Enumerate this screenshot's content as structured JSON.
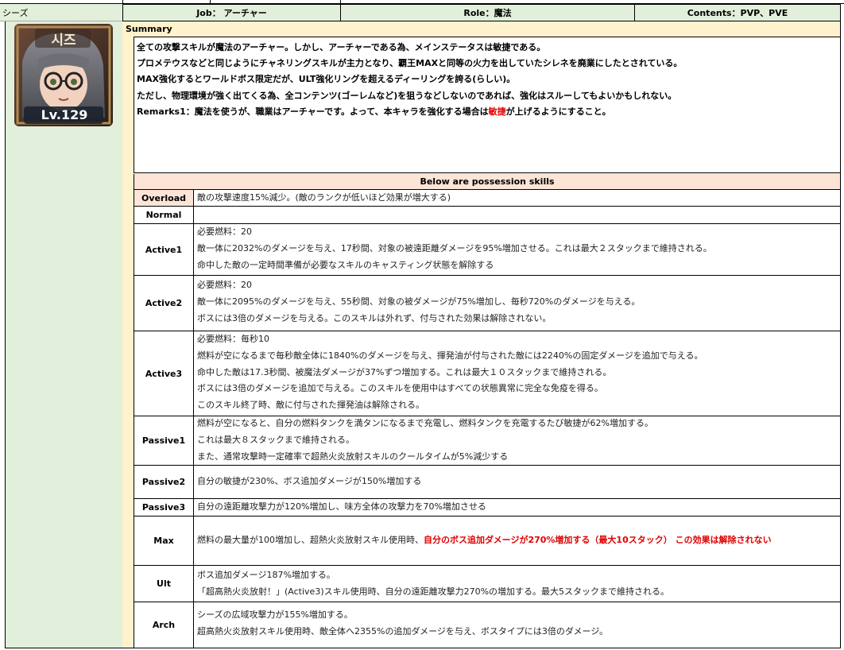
{
  "character_name": "シーズ",
  "header": {
    "job": "Job： アーチャー",
    "role": "Role：魔法",
    "contents": "Contents：PVP、PVE"
  },
  "avatar": {
    "name_badge": "시즈",
    "level": "Lv.129"
  },
  "summary": {
    "title": "Summary",
    "lines": [
      "全ての攻撃スキルが魔法のアーチャー。しかし、アーチャーである為、メインステータスは敏捷である。",
      "プロメテウスなどと同じようにチャネリングスキルが主力となり、覇王MAXと同等の火力を出していたシレネを廃業にしたとされている。",
      "MAX強化するとワールドボス限定だが、ULT強化リングを超えるディーリングを誇る(らしい)。",
      "ただし、物理環境が強く出てくる為、全コンテンツ(ゴーレムなど)を狙うなどしないのであれば、強化はスルーしてもよいかもしれない。"
    ],
    "remarks_prefix": "Remarks1：魔法を使うが、職業はアーチャーです。よって、本キャラを強化する場合は",
    "remarks_highlight": "敏捷",
    "remarks_suffix": "が上げるようにすること。"
  },
  "skills_title": "Below are possession skills",
  "skills": {
    "overload": {
      "label": "Overload",
      "lines": [
        "敵の攻撃速度15%減少。(敵のランクが低いほど効果が増大する)"
      ]
    },
    "normal": {
      "label": "Normal",
      "lines": []
    },
    "active1": {
      "label": "Active1",
      "lines": [
        "必要燃料：20",
        "敵一体に2032%のダメージを与え、17秒間、対象の被遠距離ダメージを95%増加させる。これは最大２スタックまで維持される。",
        "命中した敵の一定時間準備が必要なスキルのキャスティング状態を解除する"
      ]
    },
    "active2": {
      "label": "Active2",
      "lines": [
        "必要燃料：20",
        "敵一体に2095%のダメージを与え、55秒間、対象の被ダメージが75%増加し、毎秒720%のダメージを与える。",
        "ボスには3倍のダメージを与える。このスキルは外れず、付与された効果は解除されない。"
      ]
    },
    "active3": {
      "label": "Active3",
      "lines": [
        "必要燃料：毎秒10",
        "燃料が空になるまで毎秒敵全体に1840%のダメージを与え、揮発油が付与された敵には2240%の固定ダメージを追加で与える。",
        "命中した敵は17.3秒間、被魔法ダメージが37%ずつ増加する。これは最大１０スタックまで維持される。",
        "ボスには3倍のダメージを追加で与える。このスキルを使用中はすべての状態異常に完全な免疫を得る。",
        "このスキル終了時、敵に付与された揮発油は解除される。"
      ]
    },
    "passive1": {
      "label": "Passive1",
      "lines": [
        "燃料が空になると、自分の燃料タンクを満タンになるまで充電し、燃料タンクを充電するたび敏捷が62%増加する。",
        "これは最大８スタックまで維持される。",
        "また、通常攻撃時一定確率で超熱火炎放射スキルのクールタイムが5%減少する"
      ]
    },
    "passive2": {
      "label": "Passive2",
      "lines": [
        "自分の敏捷が230%、ボス追加ダメージが150%増加する"
      ]
    },
    "passive3": {
      "label": "Passive3",
      "lines": [
        "自分の遠距離攻撃力が120%増加し、味方全体の攻撃力を70%増加させる"
      ]
    },
    "max": {
      "label": "Max",
      "prefix": "燃料の最大量が100増加し、超熱火炎放射スキル使用時、",
      "highlight": "自分のボス追加ダメージが270%増加する（最大10スタック） この効果は解除されない"
    },
    "ult": {
      "label": "Ult",
      "lines": [
        "ボス追加ダメージ187%増加する。",
        "「超高熱火炎放射！」(Active3)スキル使用時、自分の遠距離攻撃力270%の増加する。最大5スタックまで維持される。"
      ]
    },
    "arch": {
      "label": "Arch",
      "lines": [
        "シーズの広域攻撃力が155%増加する。",
        "超高熱火炎放射スキル使用時、敵全体へ2355%の追加ダメージを与え、ボスタイプには3倍のダメージ。"
      ]
    }
  },
  "colors": {
    "green": "#e2efda",
    "cream": "#fff2cc",
    "orange": "#fce4d6",
    "highlight_red": "#e00000"
  }
}
